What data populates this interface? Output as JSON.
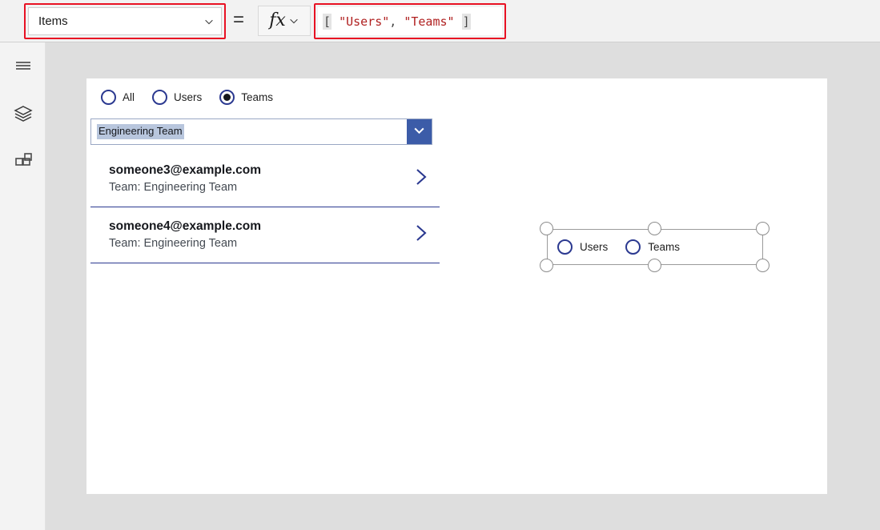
{
  "formula_bar": {
    "property_dropdown": {
      "value": "Items",
      "chevron_icon": "chevron-down-icon"
    },
    "equals": "=",
    "fx": {
      "glyph": "fx",
      "chevron_icon": "chevron-down-icon"
    },
    "formula": {
      "open_bracket": "[",
      "string_1": "\"Users\"",
      "separator": ", ",
      "string_2": "\"Teams\"",
      "close_bracket": "]",
      "full_text": "[ \"Users\", \"Teams\" ]"
    }
  },
  "left_rail": {
    "items": [
      {
        "name": "menu",
        "icon": "hamburger-menu-icon"
      },
      {
        "name": "tree-view",
        "icon": "layers-icon"
      },
      {
        "name": "insert",
        "icon": "insert-components-icon"
      }
    ]
  },
  "canvas": {
    "filter_radio_group": {
      "options": [
        {
          "label": "All",
          "selected": false
        },
        {
          "label": "Users",
          "selected": false
        },
        {
          "label": "Teams",
          "selected": true
        }
      ]
    },
    "team_dropdown": {
      "value": "Engineering Team",
      "chevron_icon": "chevron-down-icon"
    },
    "gallery": {
      "items": [
        {
          "title": "someone3@example.com",
          "subtitle": "Team: Engineering Team",
          "chevron_icon": "chevron-right-icon"
        },
        {
          "title": "someone4@example.com",
          "subtitle": "Team: Engineering Team",
          "chevron_icon": "chevron-right-icon"
        }
      ]
    },
    "selected_control": {
      "type": "radio-group",
      "options": [
        {
          "label": "Users",
          "selected": false
        },
        {
          "label": "Teams",
          "selected": false
        }
      ],
      "handles": [
        "top-left",
        "top-center",
        "top-right",
        "bottom-left",
        "bottom-center",
        "bottom-right"
      ]
    }
  },
  "colors": {
    "highlight_red": "#e81123",
    "accent_blue": "#2b3990",
    "dropdown_blue": "#3c5ca8",
    "selection_highlight": "#b8c6dd",
    "formula_string": "#b02020",
    "workspace_bg": "#dedede"
  }
}
